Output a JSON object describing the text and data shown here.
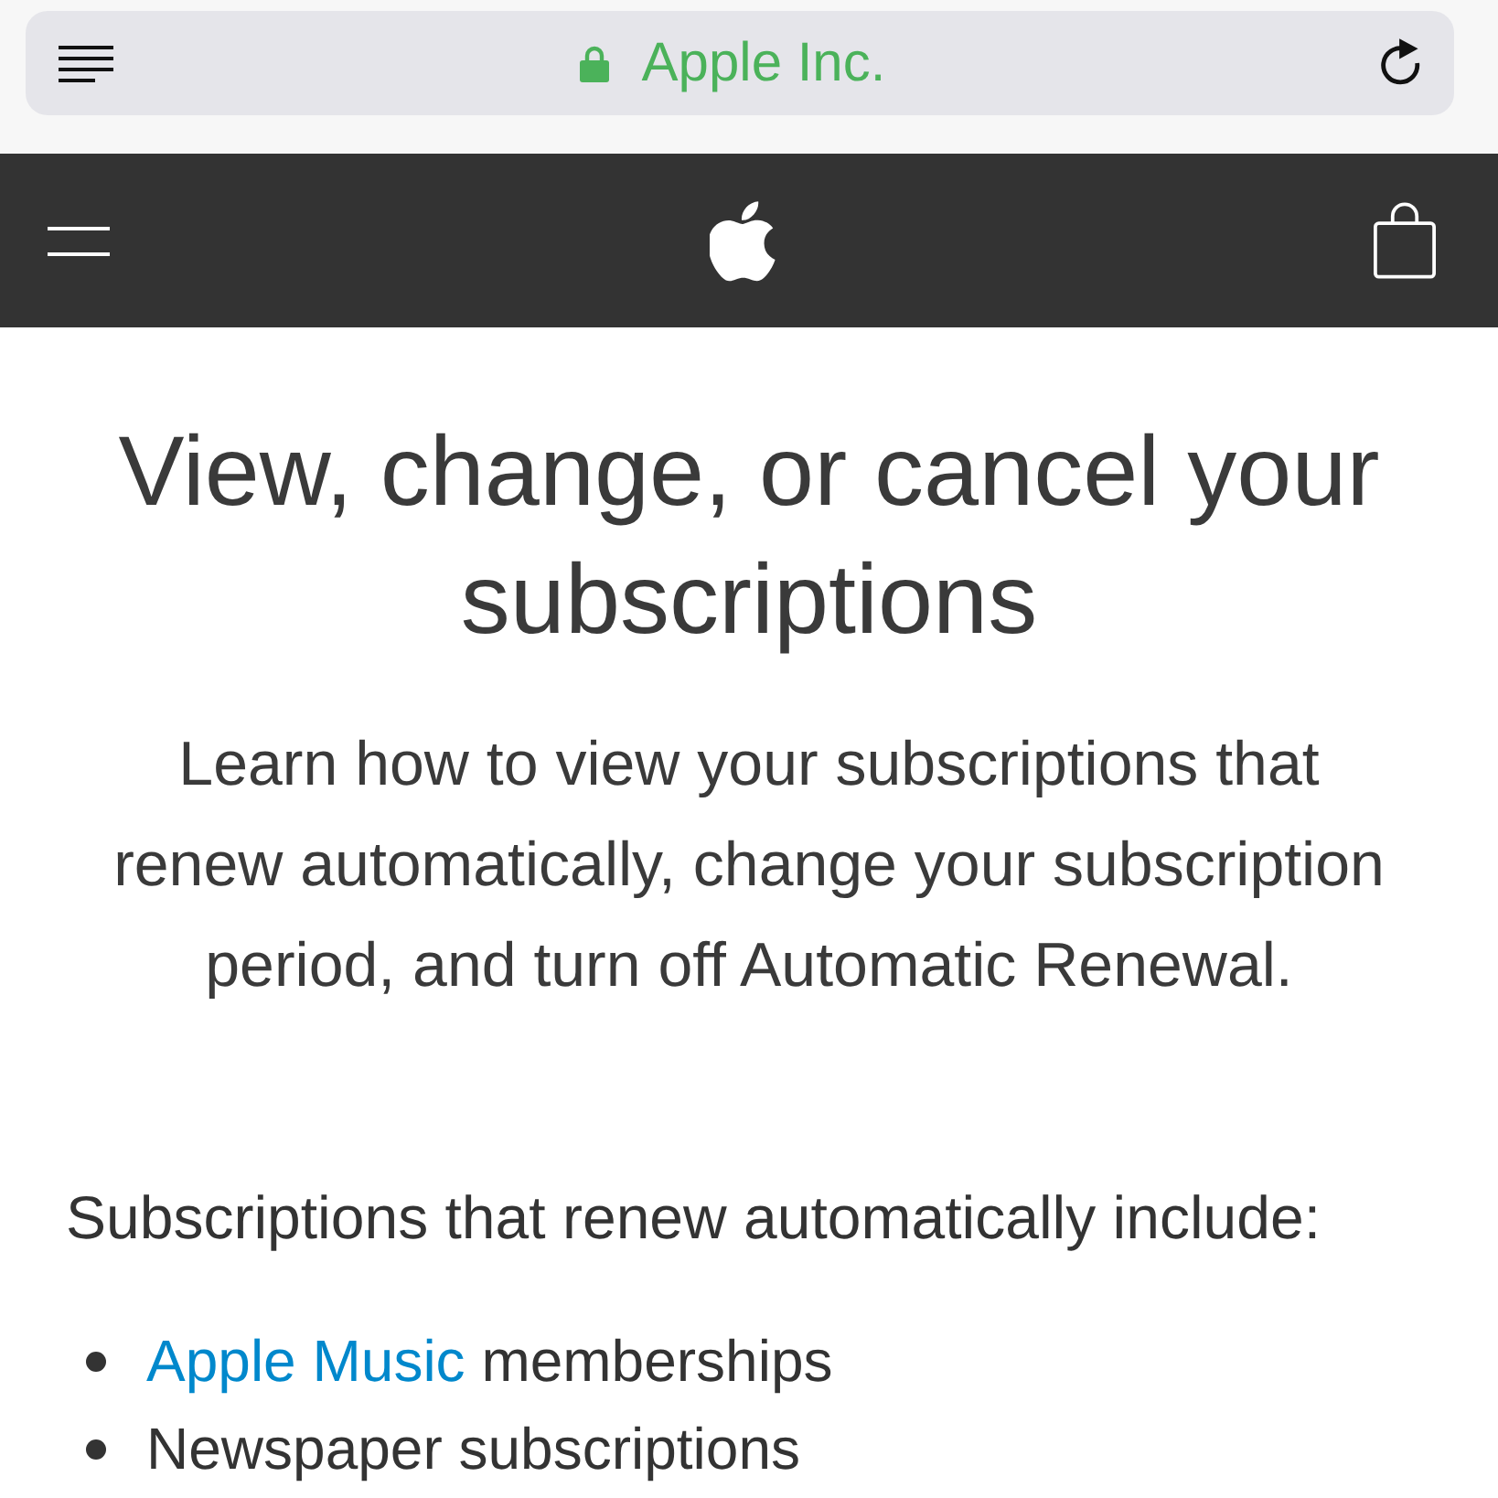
{
  "browser_bar": {
    "site_name": "Apple Inc.",
    "secure": true
  },
  "article": {
    "title": "View, change, or cancel your subscriptions",
    "intro": "Learn how to view your subscriptions that renew automatically, change your subscription period, and turn off Automatic Renewal.",
    "section_heading": "Subscriptions that renew automatically include:",
    "list": [
      {
        "link": "Apple Music",
        "text": "memberships"
      },
      {
        "text": "Newspaper subscriptions"
      }
    ]
  }
}
